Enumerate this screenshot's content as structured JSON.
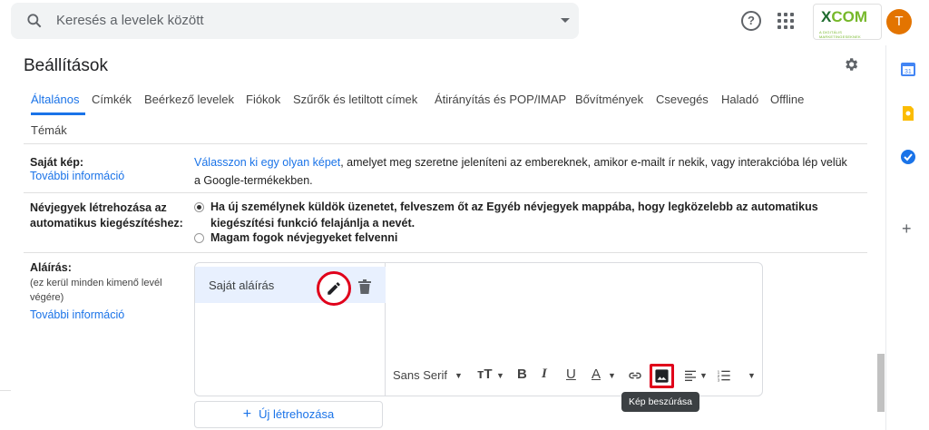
{
  "search": {
    "placeholder": "Keresés a levelek között"
  },
  "header": {
    "logo_text": "COM",
    "logo_x": "X",
    "logo_sub": "A DIGITÁLIS MARKETINGESEKNEK",
    "avatar_initial": "T"
  },
  "page": {
    "title": "Beállítások"
  },
  "tabs": [
    {
      "label": "Általános",
      "active": true
    },
    {
      "label": "Címkék"
    },
    {
      "label": "Beérkező levelek"
    },
    {
      "label": "Fiókok"
    },
    {
      "label": "Szűrők és letiltott címek"
    },
    {
      "label": "Átirányítás és POP/IMAP"
    },
    {
      "label": "Bővítmények"
    },
    {
      "label": "Csevegés"
    },
    {
      "label": "Haladó"
    },
    {
      "label": "Offline"
    },
    {
      "label": "Témák"
    }
  ],
  "profile_pic": {
    "label": "Saját kép:",
    "more_info": "További információ",
    "link_text": "Válasszon ki egy olyan képet",
    "text_rest": ", amelyet meg szeretne jeleníteni az embereknek, amikor e-mailt ír nekik, vagy interakcióba lép velük a Google-termékekben."
  },
  "contacts": {
    "label_line1": "Névjegyek létrehozása az",
    "label_line2": "automatikus kiegészítéshez:",
    "option1": "Ha új személynek küldök üzenetet, felveszem őt az Egyéb névjegyek mappába, hogy legközelebb az automatikus kiegészítési funkció felajánlja a nevét.",
    "option2": "Magam fogok névjegyeket felvenni",
    "selected": 1
  },
  "signature": {
    "label": "Aláírás:",
    "note_line1": "(ez kerül minden kimenő levél",
    "note_line2": "végére)",
    "more_info": "További információ",
    "items": [
      "Saját aláírás"
    ],
    "font": "Sans Serif",
    "tooltip": "Kép beszúrása",
    "new_button": "Új létrehozása",
    "new_button_icon": "+"
  },
  "icons": {
    "search": "search-icon",
    "dropdown": "chevron-down-icon",
    "help": "help-icon",
    "apps": "apps-grid-icon",
    "settings": "gear-icon",
    "edit": "pencil-icon",
    "delete": "trash-icon",
    "insert_image": "image-icon",
    "calendar": "calendar-icon",
    "keep": "keep-icon",
    "tasks": "tasks-icon",
    "add": "plus-icon"
  },
  "colors": {
    "accent": "#1a73e8",
    "highlight": "#e0001a",
    "avatar": "#e37400",
    "selected_bg": "#e8f0fe"
  }
}
